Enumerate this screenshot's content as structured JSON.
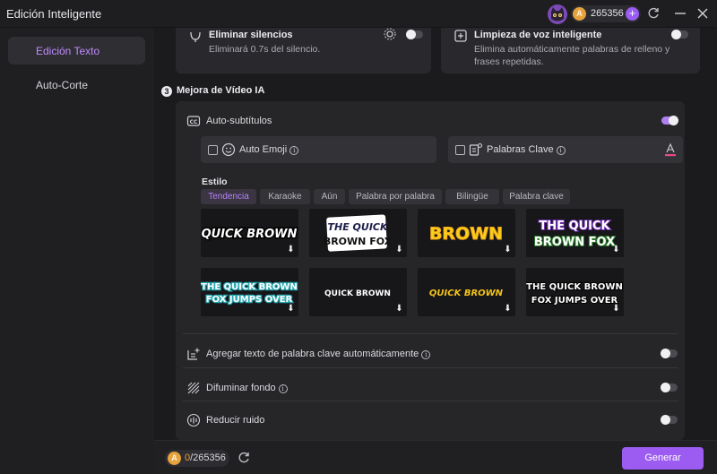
{
  "window": {
    "title": "Edición Inteligente"
  },
  "account": {
    "coin_symbol": "A",
    "coins": "265356",
    "plus": "+"
  },
  "sidebar": {
    "items": [
      {
        "label": "Edición Texto"
      },
      {
        "label": "Auto-Corte"
      }
    ]
  },
  "top_cards": [
    {
      "title": "Eliminar silencios",
      "desc": "Eliminará 0.7s del silencio."
    },
    {
      "title": "Limpieza de voz inteligente",
      "desc": "Elimina automáticamente palabras de relleno y frases repetidas."
    }
  ],
  "section": {
    "number": "3",
    "title": "Mejora de Vídeo IA"
  },
  "auto_subtitles": {
    "label": "Auto-subtítulos",
    "enabled": true
  },
  "options": {
    "auto_emoji": {
      "label": "Auto Emoji",
      "checked": false
    },
    "keywords": {
      "label": "Palabras Clave",
      "checked": false
    }
  },
  "style": {
    "label": "Estilo",
    "tabs": [
      "Tendencia",
      "Karaoke",
      "Aún",
      "Palabra por palabra",
      "Bilingüe",
      "Palabra clave"
    ],
    "active_tab": 0,
    "presets": [
      {
        "lines": [
          "QUICK BROWN"
        ]
      },
      {
        "lines": [
          "THE QUICK",
          "BROWN FOX"
        ]
      },
      {
        "lines": [
          "BROWN"
        ]
      },
      {
        "lines": [
          "THE QUICK",
          "BROWN FOX"
        ]
      },
      {
        "lines": [
          "THE QUICK BROWN",
          "FOX JUMPS OVER"
        ]
      },
      {
        "lines": [
          "QUICK BROWN"
        ]
      },
      {
        "lines": [
          "QUICK BROWN"
        ]
      },
      {
        "lines": [
          "THE QUICK BROWN",
          "FOX JUMPS OVER"
        ]
      }
    ]
  },
  "settings": [
    {
      "label": "Agregar texto de palabra clave automáticamente",
      "enabled": false,
      "has_info": true
    },
    {
      "label": "Difuminar fondo",
      "enabled": false,
      "has_info": true
    },
    {
      "label": "Reducir ruido",
      "enabled": false,
      "has_info": false
    }
  ],
  "footer": {
    "coin_symbol": "A",
    "used": "0",
    "total": "/265356",
    "generate_label": "Generar"
  },
  "colors": {
    "accent": "#9c5cf2",
    "accent_text": "#c28bff",
    "coin": "#e6a23c"
  }
}
